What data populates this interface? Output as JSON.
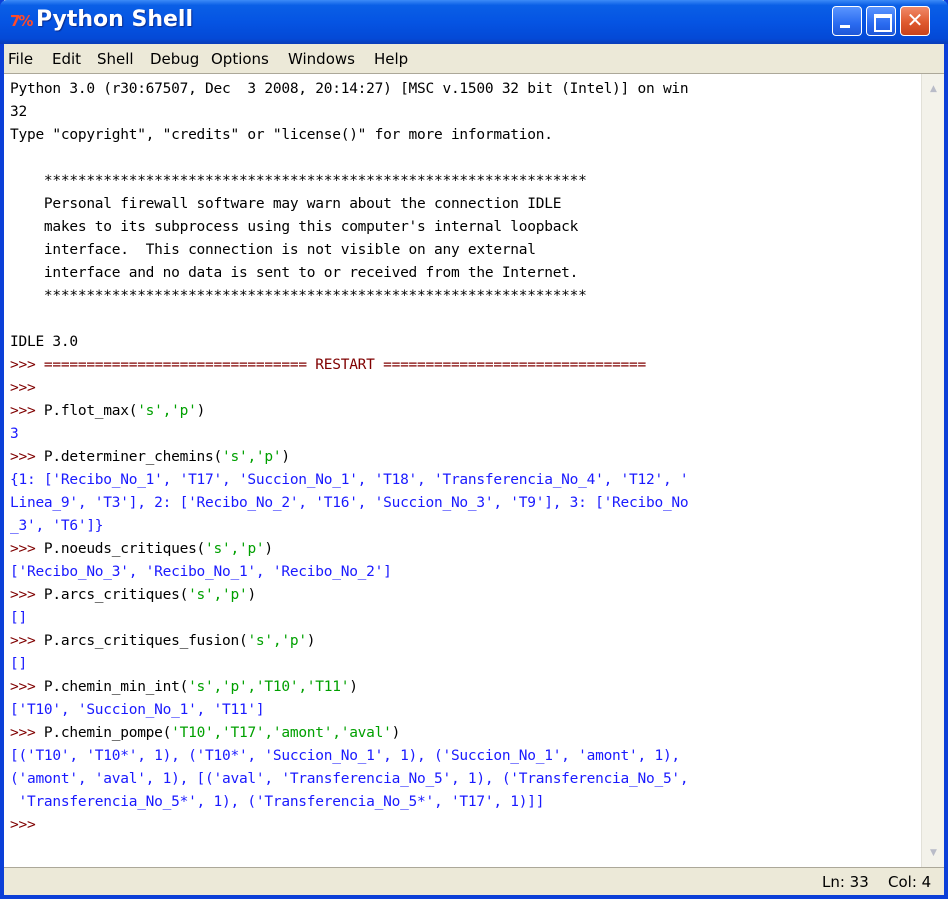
{
  "window": {
    "title": "Python Shell",
    "app_icon": "idle-logo-icon"
  },
  "menu": [
    "File",
    "Edit",
    "Shell",
    "Debug",
    "Options",
    "Windows",
    "Help"
  ],
  "shell": {
    "header_line1": "Python 3.0 (r30:67507, Dec  3 2008, 20:14:27) [MSC v.1500 32 bit (Intel)] on win",
    "header_line2": "32",
    "header_line3": "Type \"copyright\", \"credits\" or \"license()\" for more information.",
    "banner_stars": "    ****************************************************************",
    "banner_lines": [
      "    Personal firewall software may warn about the connection IDLE",
      "    makes to its subprocess using this computer's internal loopback",
      "    interface.  This connection is not visible on any external",
      "    interface and no data is sent to or received from the Internet."
    ],
    "idle_version": "IDLE 3.0",
    "prompt": ">>> ",
    "restart_line": "=============================== RESTART ===============================",
    "entries": [
      {
        "cmd_pre": "P.flot_max(",
        "cmd_args": "'s','p'",
        "cmd_post": ")"
      },
      {
        "cmd_pre": "P.determiner_chemins(",
        "cmd_args": "'s','p'",
        "cmd_post": ")"
      },
      {
        "cmd_pre": "P.noeuds_critiques(",
        "cmd_args": "'s','p'",
        "cmd_post": ")"
      },
      {
        "cmd_pre": "P.arcs_critiques(",
        "cmd_args": "'s','p'",
        "cmd_post": ")"
      },
      {
        "cmd_pre": "P.arcs_critiques_fusion(",
        "cmd_args": "'s','p'",
        "cmd_post": ")"
      },
      {
        "cmd_pre": "P.chemin_min_int(",
        "cmd_args": "'s','p','T10','T11'",
        "cmd_post": ")"
      },
      {
        "cmd_pre": "P.chemin_pompe(",
        "cmd_args": "'T10','T17','amont','aval'",
        "cmd_post": ")"
      }
    ],
    "outputs": {
      "flot_max": "3",
      "determiner_chemins": [
        "{1: ['Recibo_No_1', 'T17', 'Succion_No_1', 'T18', 'Transferencia_No_4', 'T12', '",
        "Linea_9', 'T3'], 2: ['Recibo_No_2', 'T16', 'Succion_No_3', 'T9'], 3: ['Recibo_No",
        "_3', 'T6']}"
      ],
      "noeuds_critiques": "['Recibo_No_3', 'Recibo_No_1', 'Recibo_No_2']",
      "arcs_critiques": "[]",
      "arcs_critiques_fusion": "[]",
      "chemin_min_int": "['T10', 'Succion_No_1', 'T11']",
      "chemin_pompe": [
        "[('T10', 'T10*', 1), ('T10*', 'Succion_No_1', 1), ('Succion_No_1', 'amont', 1),",
        "('amont', 'aval', 1), [('aval', 'Transferencia_No_5', 1), ('Transferencia_No_5',",
        " 'Transferencia_No_5*', 1), ('Transferencia_No_5*', 'T17', 1)]]"
      ]
    }
  },
  "status": {
    "line": "Ln: 33",
    "col": "Col: 4"
  },
  "colors": {
    "prompt": "#7f0000",
    "output": "#1a1aff",
    "string": "#00a000",
    "titlebar": "#0554e3"
  }
}
